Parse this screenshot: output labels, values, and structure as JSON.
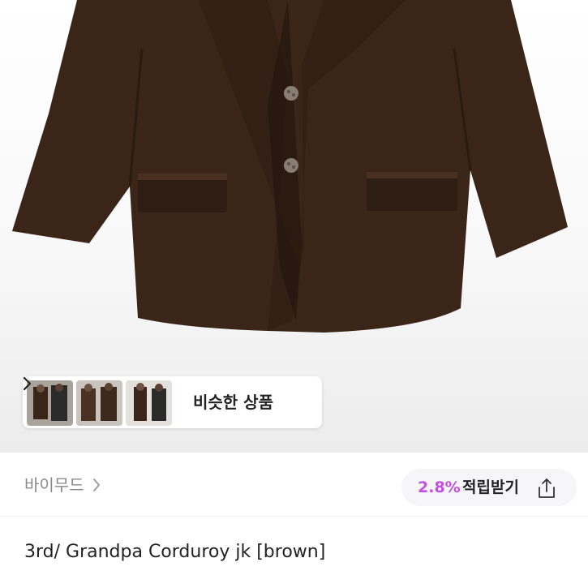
{
  "similar": {
    "label": "비슷한 상품",
    "thumbnails": [
      "thumbnail-1",
      "thumbnail-2",
      "thumbnail-3"
    ]
  },
  "seller": {
    "name": "바이무드"
  },
  "reward": {
    "rate": "2.8%",
    "label": "적립받기"
  },
  "product": {
    "title": "3rd/ Grandpa Corduroy jk [brown]"
  },
  "colors": {
    "accent": "#c44fe0",
    "jacket": "#3a2518"
  },
  "icons": [
    "chevron-right-icon",
    "share-icon"
  ]
}
